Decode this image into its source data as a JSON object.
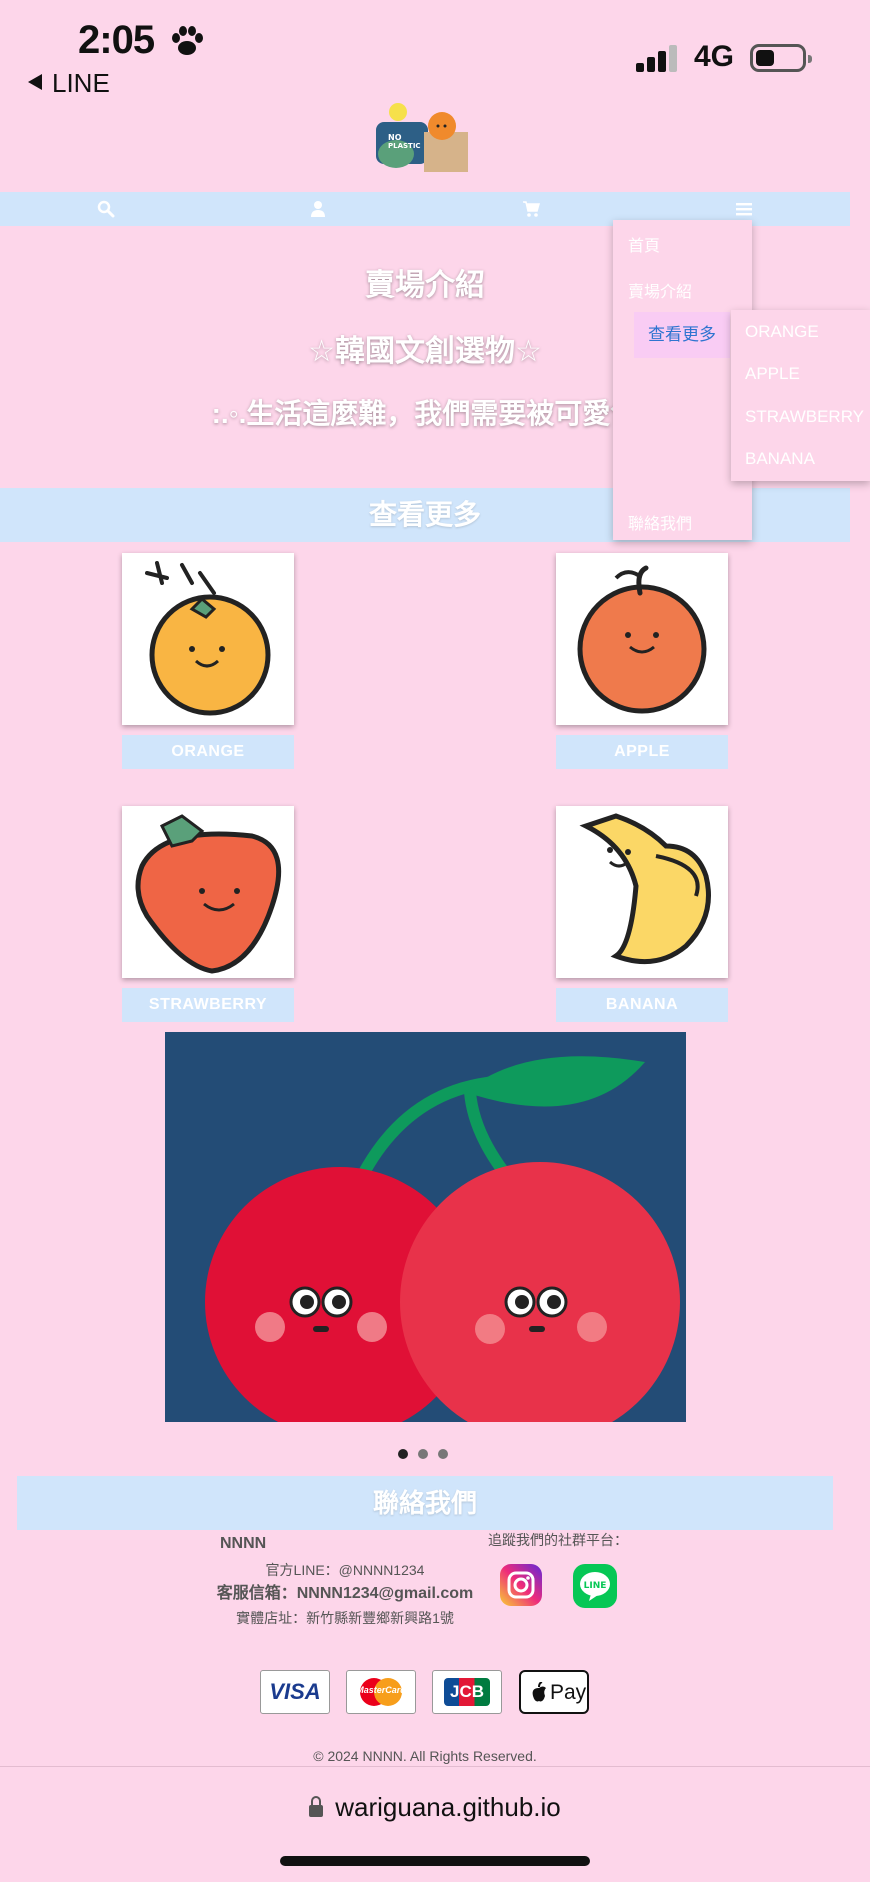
{
  "status_bar": {
    "time": "2:05",
    "back_app": "LINE",
    "network": "4G"
  },
  "nav": {
    "icons": [
      "search-icon",
      "user-icon",
      "cart-icon",
      "menu-icon"
    ]
  },
  "hero": {
    "title": "賣場介紹",
    "subtitle": "☆韓國文創選物☆",
    "tagline": ":.◦.生活這麼難，我們需要被可愛包"
  },
  "section": {
    "view_more": "查看更多"
  },
  "products": [
    {
      "name": "ORANGE"
    },
    {
      "name": "APPLE"
    },
    {
      "name": "STRAWBERRY"
    },
    {
      "name": "BANANA"
    }
  ],
  "carousel": {
    "slides": 3,
    "active": 1
  },
  "contact": {
    "heading": "聯絡我們",
    "brand": "NNNN",
    "line_id": "官方LINE：@NNNN1234",
    "email": "客服信箱：NNNN1234@gmail.com",
    "address": "實體店址：新竹縣新豐鄉新興路1號",
    "social_title": "追蹤我們的社群平台：",
    "social_icons": [
      "instagram-icon",
      "line-icon"
    ]
  },
  "payments": {
    "visa": "VISA",
    "mastercard": "MasterCard",
    "jcb": "JCB",
    "applepay": "Pay"
  },
  "copyright": "© 2024 NNNN. All Rights Reserved.",
  "menu": {
    "items": [
      "首頁",
      "賣場介紹",
      "查看更多",
      "聯絡我們"
    ],
    "active": "查看更多",
    "submenu": [
      "ORANGE",
      "APPLE",
      "STRAWBERRY",
      "BANANA"
    ]
  },
  "browser": {
    "url": "wariguana.github.io"
  },
  "colors": {
    "background": "#fdd6ea",
    "accent": "#d0e5fb",
    "active_link": "#2f74d0"
  }
}
